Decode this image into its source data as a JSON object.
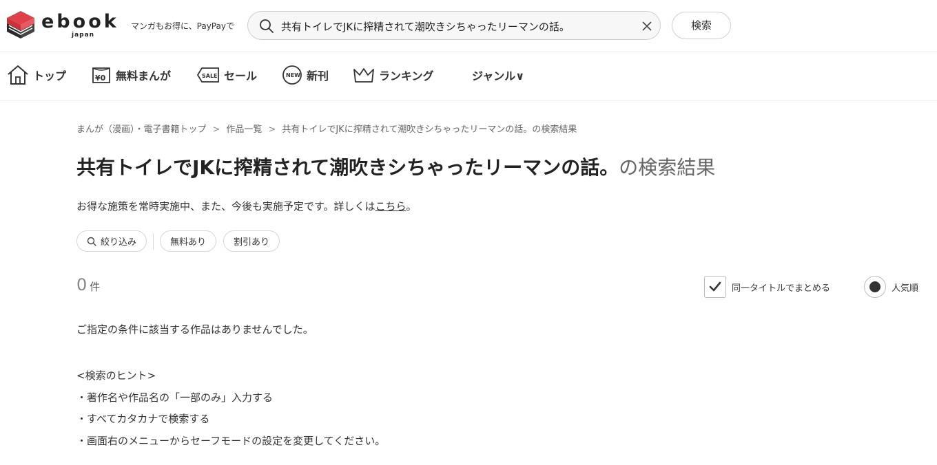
{
  "header": {
    "logo_word": "ebook",
    "logo_sub": "japan",
    "tagline": "マンガもお得に、PayPayで",
    "search_value": "共有トイレでJKに搾精されて潮吹きシちゃったリーマンの話。",
    "search_button": "検索"
  },
  "nav": {
    "items": [
      {
        "label": "トップ",
        "icon": "home-icon"
      },
      {
        "label": "無料まんが",
        "icon": "yen-free-icon"
      },
      {
        "label": "セール",
        "icon": "sale-tag-icon"
      },
      {
        "label": "新刊",
        "icon": "new-badge-icon"
      },
      {
        "label": "ランキング",
        "icon": "crown-icon"
      },
      {
        "label": "ジャンル∨",
        "icon": "chevron-down-icon"
      }
    ]
  },
  "breadcrumb": {
    "items": [
      "まんが（漫画）・電子書籍トップ",
      "作品一覧",
      "共有トイレでJKに搾精されて潮吹きシちゃったリーマンの話。の検索結果"
    ],
    "separator": ">"
  },
  "page_title": {
    "query": "共有トイレでJKに搾精されて潮吹きシちゃったリーマンの話。",
    "suffix": "の検索結果"
  },
  "promo": {
    "text": "お得な施策を常時実施中、また、今後も実施予定です。詳しくは",
    "link": "こちら",
    "end": "。"
  },
  "filters": {
    "narrow": "絞り込み",
    "free": "無料あり",
    "discount": "割引あり"
  },
  "results": {
    "count": "0",
    "unit": "件",
    "group_same_title": "同一タイトルでまとめる",
    "group_same_title_checked": true,
    "sort_label": "人気順",
    "empty_message": "ご指定の条件に該当する作品はありませんでした。"
  },
  "hints": {
    "title": "<検索のヒント>",
    "lines": [
      "・著作名や作品名の「一部のみ」入力する",
      "・すべてカタカナで検索する",
      "・画面右のメニューからセーフモードの設定を変更してください。"
    ]
  },
  "colors": {
    "logo_red": "#e0404a",
    "text": "#333333",
    "muted": "#666666",
    "border": "#d6d6d6"
  }
}
